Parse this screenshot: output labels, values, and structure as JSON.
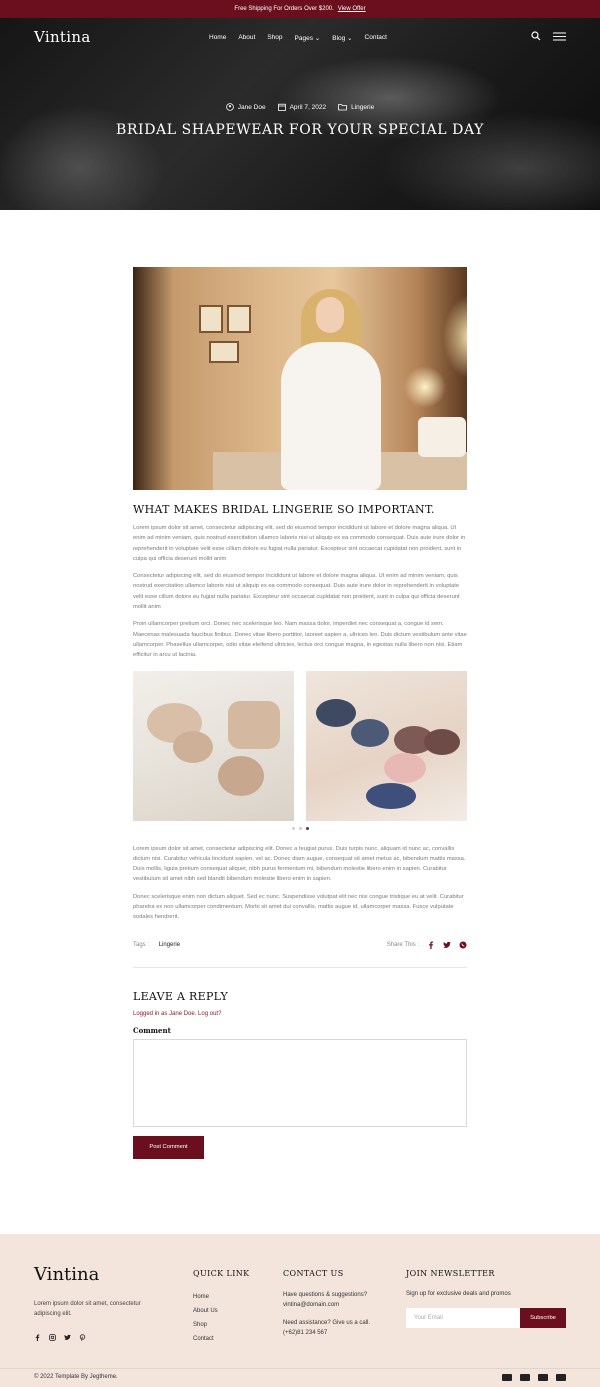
{
  "topbar": {
    "text": "Free Shipping For Orders Over $200.",
    "link": "View Offer"
  },
  "nav": {
    "logo": "Vintina",
    "items": [
      "Home",
      "About",
      "Shop",
      "Pages",
      "Blog",
      "Contact"
    ]
  },
  "hero": {
    "author": "Jane Doe",
    "date": "April 7, 2022",
    "category": "Lingerie",
    "title": "BRIDAL SHAPEWEAR FOR YOUR SPECIAL DAY"
  },
  "article": {
    "heading": "WHAT MAKES BRIDAL LINGERIE SO IMPORTANT.",
    "p1": "Lorem ipsum dolor sit amet, consectetur adipiscing elit, sed do eiusmod tempor incididunt ut labore et dolore magna aliqua. Ut enim ad minim veniam, quis nostrud exercitation ullamco laboris nisi ut aliquip ex ea commodo consequat. Duis aute irure dolor in reprehenderit in voluptate velit esse cillum dolore eu fugiat nulla pariatur. Excepteur sint occaecat cupidatat non proident, sunt in culpa qui officia deserunt mollit anim",
    "p2": "Consectetur adipiscing elit, sed do eiusmod tempor incididunt ut labore et dolore magna aliqua. Ut enim ad minim veniam, quis nostrud exercitation ullamco laboris nisi ut aliquip ex ea commodo consequat. Duis aute irure dolor in reprehenderit in voluptate velit esse cillum dolore eu fugiat nulla pariatur. Excepteur sint occaecat cupidatat non proident, sunt in culpa qui officia deserunt mollit anim",
    "p3": "Proin ullamcorper pretium orci. Donec nec scelerisque leo. Nam massa dolor, imperdiet nec consequat a, congue id sem. Maecenas malesuada faucibus finibus. Donec vitae libero porttitor, laoreet sapien a, ultrices leo. Duis dictum vestibulum ante vitae ullamcorper. Phasellus ullamcorper, odio vitae eleifend ultricies, lectus orci congue magna, in egestas nulla libero non nisi. Etiam efficitur in arcu ut lacinia.",
    "p4": "Lorem ipsum dolor sit amet, consectetur adipiscing elit. Donec a feugiat purus. Duis turpis nunc, aliquam id nunc ac, convallis dictum nisi. Curabitur vehicula tincidunt sapien, vel ac. Donec diam augue, consequat sit amet metus ac, bibendum mattis massa. Duis mollis, ligula pretium consequat aliquet, nibh purus fermentum mi, bibendum molestie libero enim in sapien. Curabitur vestibulum sit amet nibh sed blandit bibendum molestie libero enim in sapien.",
    "p5": "Donec scelerisque enim non dictum aliquet. Sed ec nunc. Suspendisse volutpat elit nec nisi congue tristique eu at velit. Curabitur pharetra ex non ullamcorper condimentum. Morbi sit amet dui convallis, mattis augue id, ullamcorper massa. Fusce vulputate sodales hendrerit.",
    "tags_label": "Tags :",
    "tag": "Lingerie",
    "share_label": "Share This :"
  },
  "reply": {
    "heading": "LEAVE A REPLY",
    "logged": "Logged in as Jane Doe. Log out?",
    "comment_label": "Comment",
    "button": "Post Comment"
  },
  "footer": {
    "logo": "Vintina",
    "desc": "Lorem ipsum dolor sit amet, consectetur adipiscing elit.",
    "quick_link_title": "QUICK LINK",
    "quick_links": [
      "Home",
      "About Us",
      "Shop",
      "Contact"
    ],
    "contact_title": "CONTACT US",
    "contact_q": "Have questions & suggestions?",
    "contact_email": "vintina@domain.com",
    "contact_help": "Need assistance? Give us a call.",
    "contact_phone": "(+62)81 234 567",
    "newsletter_title": "JOIN NEWSLETTER",
    "newsletter_desc": "Sign up for exclusive deals and promos",
    "email_placeholder": "Your Email",
    "subscribe": "Subscribe",
    "copyright": "© 2022 Template By Jegtheme."
  },
  "colors": {
    "brand": "#6b0f1e",
    "footer_bg": "#f3e5dc"
  }
}
